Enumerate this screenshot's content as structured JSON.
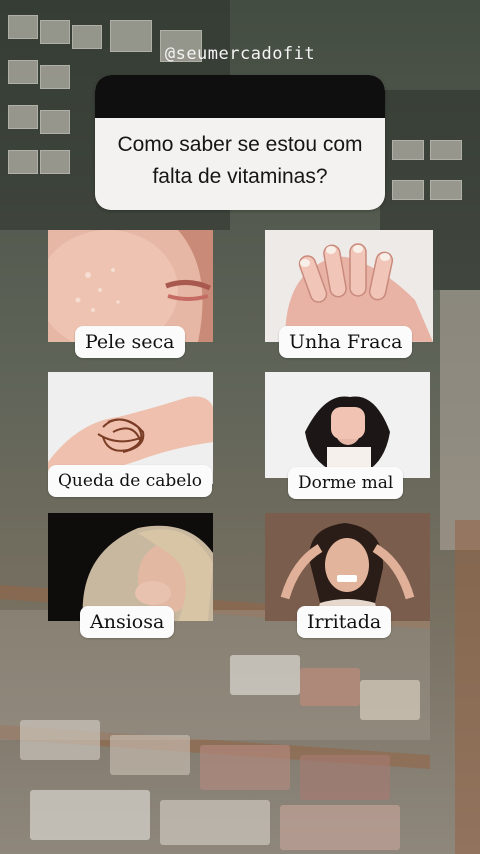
{
  "story": {
    "handle": "@seumercadofit",
    "question": "Como saber se estou com falta de vitaminas?"
  },
  "symptoms": [
    {
      "label": "Pele seca",
      "icon": "dry-skin-photo"
    },
    {
      "label": "Unha Fraca",
      "icon": "weak-nails-photo"
    },
    {
      "label": "Queda de cabelo",
      "icon": "hair-loss-photo"
    },
    {
      "label": "Dorme mal",
      "icon": "poor-sleep-photo"
    },
    {
      "label": "Ansiosa",
      "icon": "anxious-woman-photo"
    },
    {
      "label": "Irritada",
      "icon": "irritated-woman-photo"
    }
  ],
  "colors": {
    "card_background": "#f4f2f0",
    "card_header": "#0f0f0f",
    "label_background": "#fbfbfb",
    "handle_text": "#f4f4f4"
  }
}
